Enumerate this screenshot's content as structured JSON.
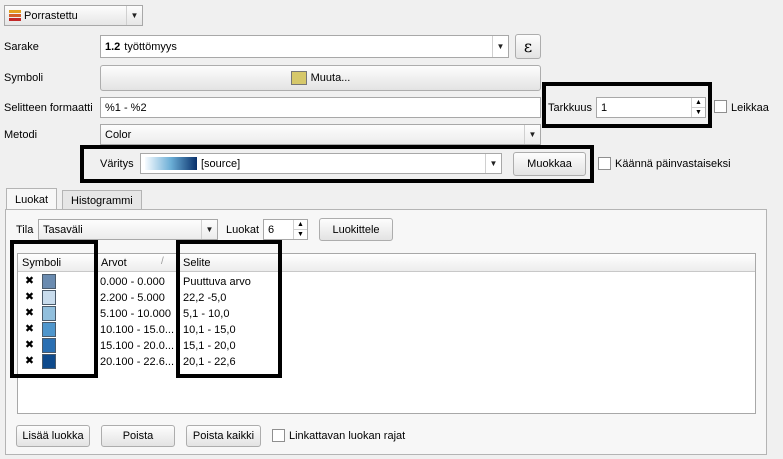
{
  "renderer": {
    "value": "Porrastettu",
    "icon": "graduated-renderer-icon"
  },
  "column": {
    "label": "Sarake",
    "type_badge": "1.2",
    "value": "työttömyys",
    "expression_button": "ε"
  },
  "symbol": {
    "label": "Symboli",
    "button": "Muuta...",
    "swatch_color": "#d6c86a"
  },
  "legend_format": {
    "label": "Selitteen formaatti",
    "value": "%1 - %2"
  },
  "precision": {
    "label": "Tarkkuus",
    "value": "1"
  },
  "trim": {
    "label": "Leikkaa"
  },
  "method": {
    "label": "Metodi",
    "value": "Color"
  },
  "color_ramp": {
    "label": "Väritys",
    "value": "[source]",
    "edit_button": "Muokkaa",
    "invert_label": "Käännä päinvastaiseksi"
  },
  "tabs": [
    {
      "label": "Luokat"
    },
    {
      "label": "Histogrammi"
    }
  ],
  "mode": {
    "label": "Tila",
    "value": "Tasaväli"
  },
  "classes": {
    "label": "Luokat",
    "value": "6",
    "classify_button": "Luokittele"
  },
  "table": {
    "headers": {
      "symbol": "Symboli",
      "values": "Arvot",
      "legend": "Selite"
    },
    "rows": [
      {
        "color": "#6a8bb0",
        "values": "0.000 - 0.000",
        "legend": "Puuttuva arvo"
      },
      {
        "color": "#c8dced",
        "values": "2.200 - 5.000",
        "legend": "22,2 -5,0"
      },
      {
        "color": "#91bfdd",
        "values": "5.100 - 10.000",
        "legend": "5,1 - 10,0"
      },
      {
        "color": "#4f96cc",
        "values": "10.100 - 15.0...",
        "legend": "10,1 - 15,0"
      },
      {
        "color": "#2a6fb2",
        "values": "15.100 - 20.0...",
        "legend": "15,1 - 20,0"
      },
      {
        "color": "#0e4a8c",
        "values": "20.100 - 22.6...",
        "legend": "20,1 - 22,6"
      }
    ]
  },
  "footer": {
    "add_button": "Lisää luokka",
    "delete_button": "Poista",
    "delete_all_button": "Poista kaikki",
    "link_label": "Linkattavan luokan rajat"
  }
}
